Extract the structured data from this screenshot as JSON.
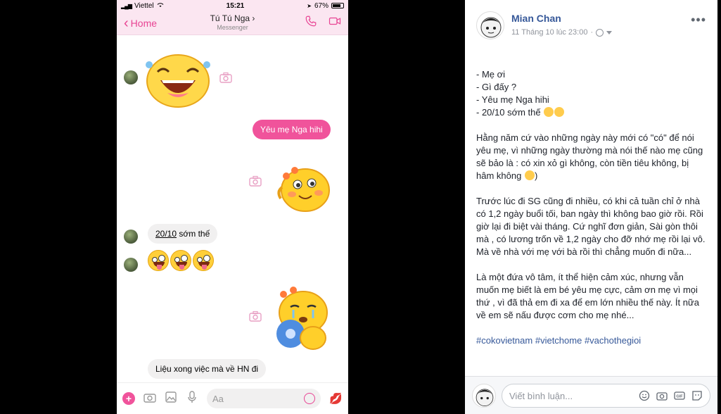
{
  "messenger": {
    "status": {
      "carrier": "Viettel",
      "time": "15:21",
      "battery": "67%"
    },
    "nav": {
      "back_label": "Home",
      "contact_name": "Tú Tú Nga",
      "subtitle": "Messenger"
    },
    "messages": {
      "out_1": "Yêu mẹ Nga hihi",
      "in_date": "20/10",
      "in_1_rest": " sớm thế",
      "in_2": "Liệu xong việc mà về HN đi"
    },
    "composer": {
      "placeholder": "Aa"
    }
  },
  "post": {
    "author": "Mian Chan",
    "timestamp": "11 Tháng 10 lúc 23:00",
    "separator": "·",
    "more": "•••",
    "lines": [
      "- Mẹ ơi",
      "- Gì đấy ?",
      "- Yêu mẹ Nga hihi",
      "- 20/10 sớm thế"
    ],
    "para1": "Hằng năm cứ vào những ngày này mới có \"có\" để nói yêu mẹ, vì những ngày thường mà nói thế nào mẹ cũng sẽ bảo là : có xin xỏ gì không, còn tiền tiêu không, bị hâm không",
    "para1_end": ")",
    "para2": "Trước lúc đi SG cũng đi nhiều, có khi cả tuần chỉ ở nhà có 1,2 ngày buổi tối, ban ngày thì không bao giờ rồi. Rồi giờ lại đi biệt vài tháng. Cứ nghĩ đơn giản, Sài gòn thôi mà , có lương trốn về 1,2 ngày cho đỡ nhớ mẹ rồi lại vô. Mà về nhà với mẹ với bà rồi thì chẳng muốn đi nữa...",
    "para3": "Là một đứa vô tâm, ít thể hiện cảm xúc, nhưng vẫn muốn mẹ biết là em bé yêu mẹ cực, cảm ơn mẹ vì mọi thứ , vì đã thả em đi xa để em lớn nhiều thế này. Ít nữa về em sẽ nấu được cơm cho mẹ nhé...",
    "hashtags": [
      "#cokovietnam",
      "#vietchome",
      "#vachothegioi"
    ],
    "comment_placeholder": "Viết bình luận..."
  },
  "colors": {
    "messenger_pink": "#f0539b",
    "fb_link": "#365899",
    "fb_meta": "#90949c"
  }
}
